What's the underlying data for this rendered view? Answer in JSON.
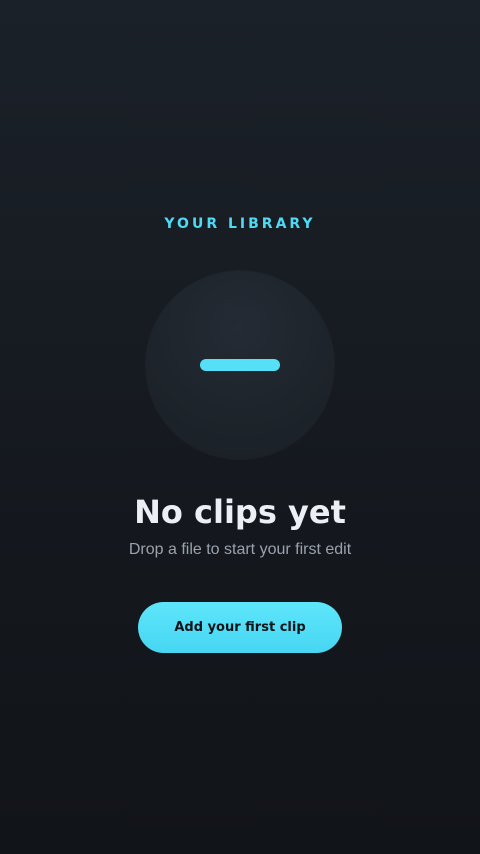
{
  "library": {
    "eyebrow": "YOUR LIBRARY"
  },
  "empty_state": {
    "icon": "minus-icon",
    "title": "No clips yet",
    "subtitle": "Drop a file to start your first edit",
    "cta_label": "Add your first clip"
  },
  "colors": {
    "accent": "#4fd9f3",
    "button": "#56e0f8",
    "background_top": "#1b2129",
    "background_bottom": "#111418",
    "title_text": "#eceff3",
    "subtitle_text": "#9aa2ad"
  }
}
